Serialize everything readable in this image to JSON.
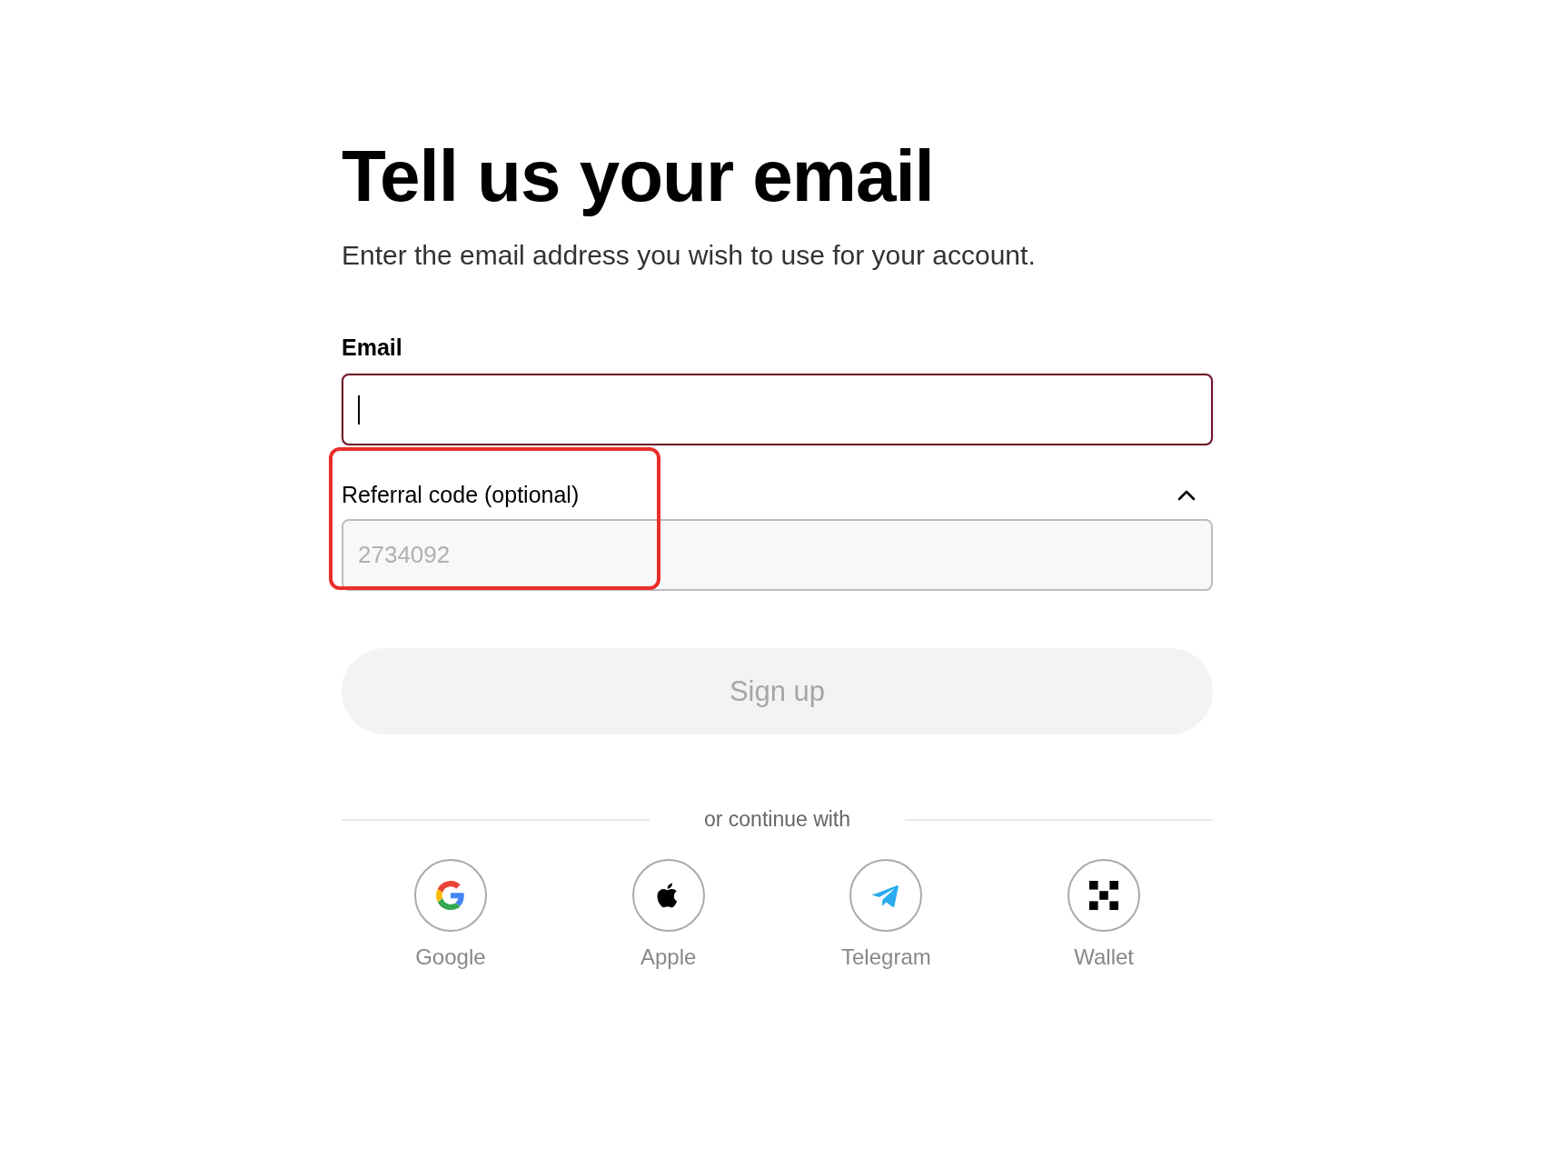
{
  "title": "Tell us your email",
  "subtitle": "Enter the email address you wish to use for your account.",
  "email": {
    "label": "Email",
    "focused": true
  },
  "referral": {
    "label": "Referral code (optional)",
    "placeholder": "2734092",
    "expanded": true,
    "highlighted": true
  },
  "submit": {
    "label": "Sign up",
    "disabled": true
  },
  "divider": "or continue with",
  "providers": [
    {
      "kind": "google",
      "label": "Google"
    },
    {
      "kind": "apple",
      "label": "Apple"
    },
    {
      "kind": "telegram",
      "label": "Telegram"
    },
    {
      "kind": "wallet",
      "label": "Wallet"
    }
  ]
}
